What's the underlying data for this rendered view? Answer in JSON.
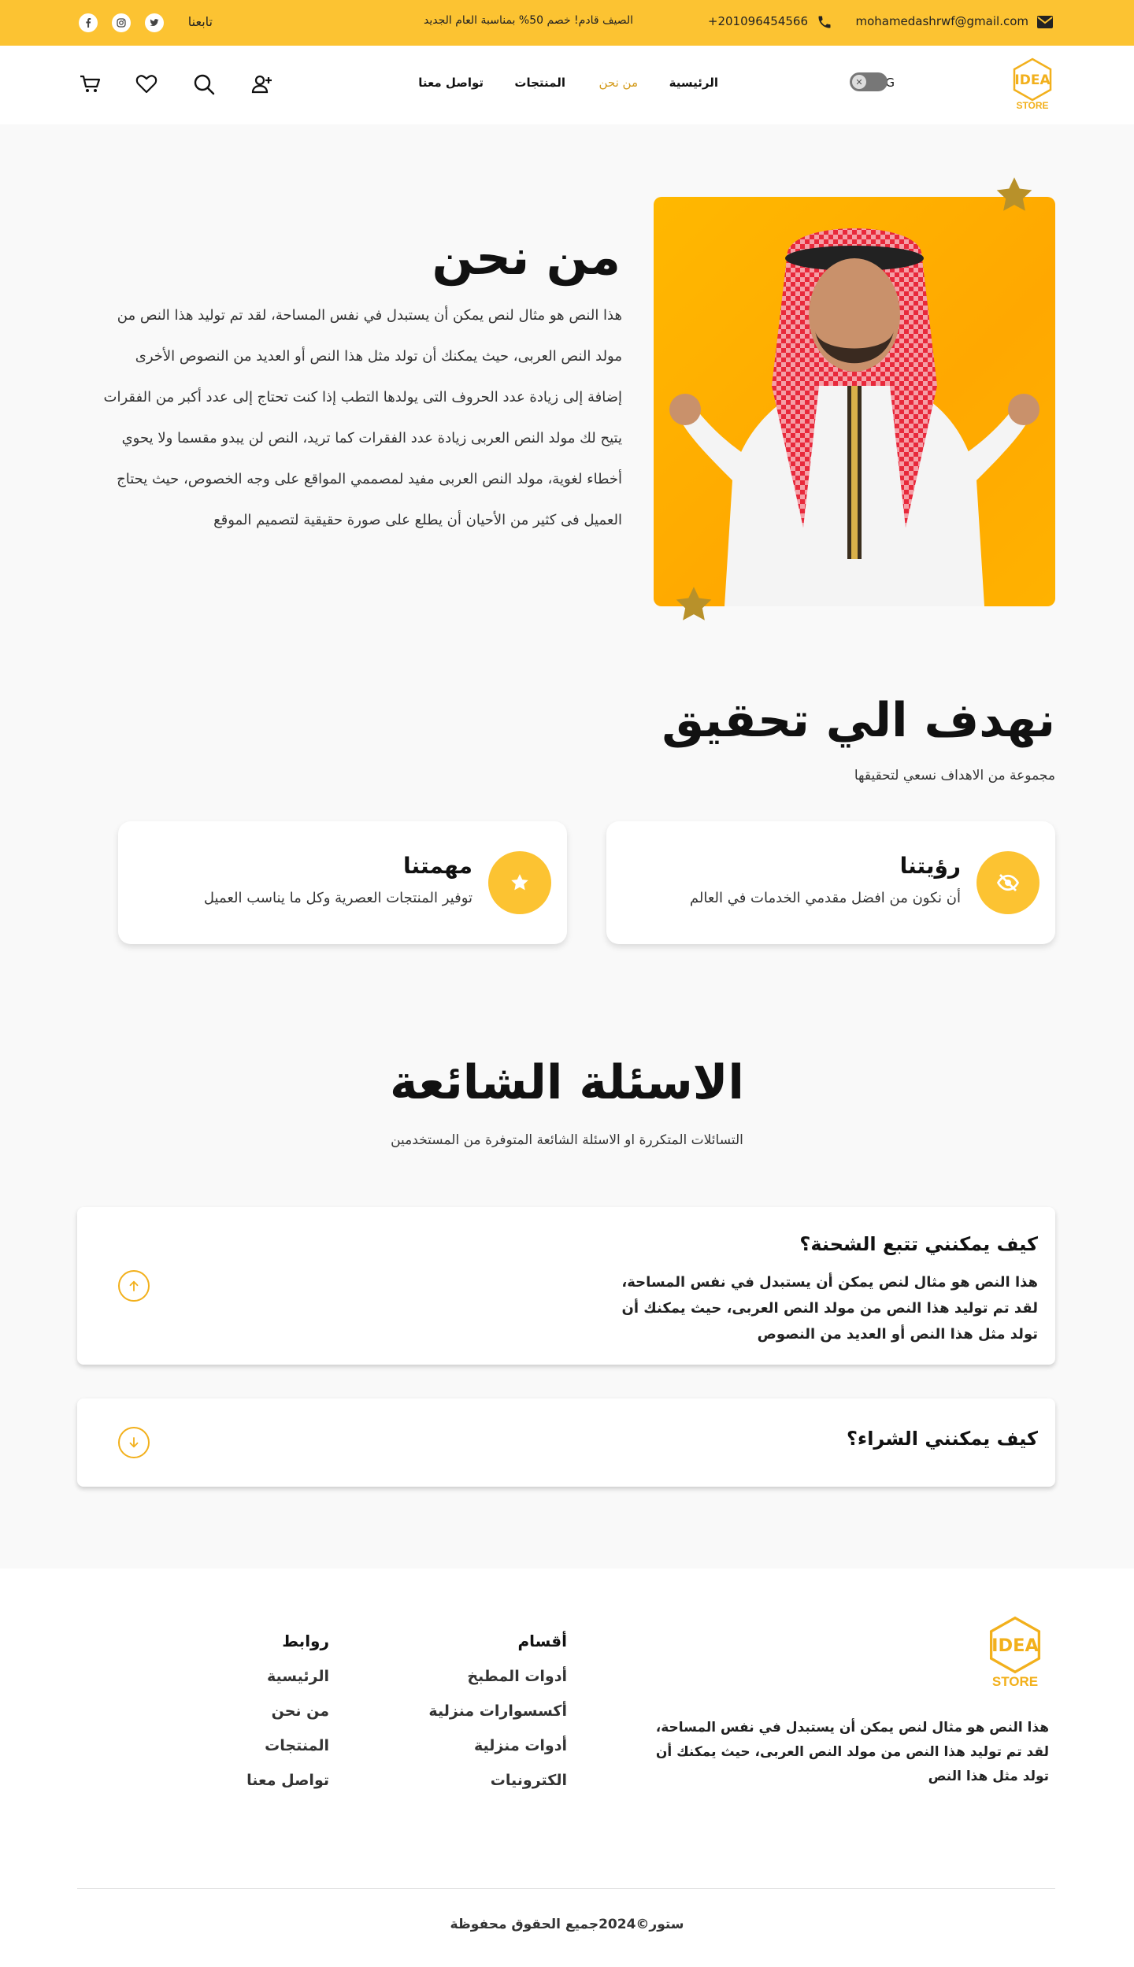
{
  "topbar": {
    "email": "mohamedashrwf@gmail.com",
    "phone": "+201096454566",
    "promo": "الصيف قادم! خصم 50% بمناسبة العام الجديد",
    "follow_label": "تابعنا",
    "social_icons": [
      "twitter-icon",
      "instagram-icon",
      "facebook-icon"
    ]
  },
  "nav": {
    "logo_text": "STORE",
    "lang_label": "ENG",
    "links": [
      "الرئيسية",
      "من نحن",
      "المنتجات",
      "تواصل معنا"
    ],
    "active_link": "من نحن"
  },
  "about": {
    "title": "من نحن",
    "body": "هذا النص هو مثال لنص يمكن أن يستبدل في نفس المساحة، لقد تم توليد هذا النص من مولد النص العربى، حيث يمكنك أن تولد مثل هذا النص أو العديد من النصوص الأخرى إضافة إلى زيادة عدد الحروف التى يولدها التطب إذا كنت تحتاج إلى عدد أكبر من الفقرات يتيح لك مولد النص العربى زيادة عدد الفقرات كما تريد، النص لن يبدو مقسما ولا يحوي أخطاء لغوية، مولد النص العربى مفيد لمصممي المواقع على وجه الخصوص، حيث يحتاج العميل فى كثير من الأحيان أن يطلع على صورة حقيقية لتصميم الموقع"
  },
  "goals": {
    "title": "نهدف الي تحقيق",
    "subtitle": "مجموعة من الاهداف نسعي لتحقيقها",
    "cards": [
      {
        "title": "رؤيتنا",
        "desc": "أن نكون من افضل مقدمي الخدمات في العالم",
        "icon": "eye-slash-icon"
      },
      {
        "title": "مهمتنا",
        "desc": "توفير المنتجات العصرية وكل ما يناسب العميل",
        "icon": "star-icon"
      }
    ]
  },
  "faq": {
    "title": "الاسئلة الشائعة",
    "subtitle": "التسائلات المتكررة او الاسئلة الشائعة المتوفرة من المستخدمين",
    "items": [
      {
        "q": "كيف يمكنني تتبع الشحنة؟",
        "a": "هذا النص هو مثال لنص يمكن أن يستبدل في نفس المساحة، لقد تم توليد هذا النص من مولد النص العربى، حيث يمكنك أن تولد مثل هذا النص أو العديد من النصوص"
      },
      {
        "q": "كيف يمكنني الشراء؟",
        "a": ""
      }
    ]
  },
  "footer": {
    "logo_text": "STORE",
    "desc": "هذا النص هو مثال لنص يمكن أن يستبدل في نفس المساحة، لقد تم توليد هذا النص من مولد النص العربى، حيث يمكنك أن تولد مثل هذا النص",
    "sections_title": "أقسام",
    "sections": [
      "أدوات المطبخ",
      "أكسسوارات منزلية",
      "أدوات منزلية",
      "الكترونيات"
    ],
    "links_title": "روابط",
    "links": [
      "الرئيسية",
      "من نحن",
      "المنتجات",
      "تواصل معنا"
    ],
    "copyright": "ستور©2024جميع الحقوق محفوظة"
  },
  "colors": {
    "accent": "#fcc332",
    "star": "#b8912a",
    "active_link": "#d39a1a"
  }
}
